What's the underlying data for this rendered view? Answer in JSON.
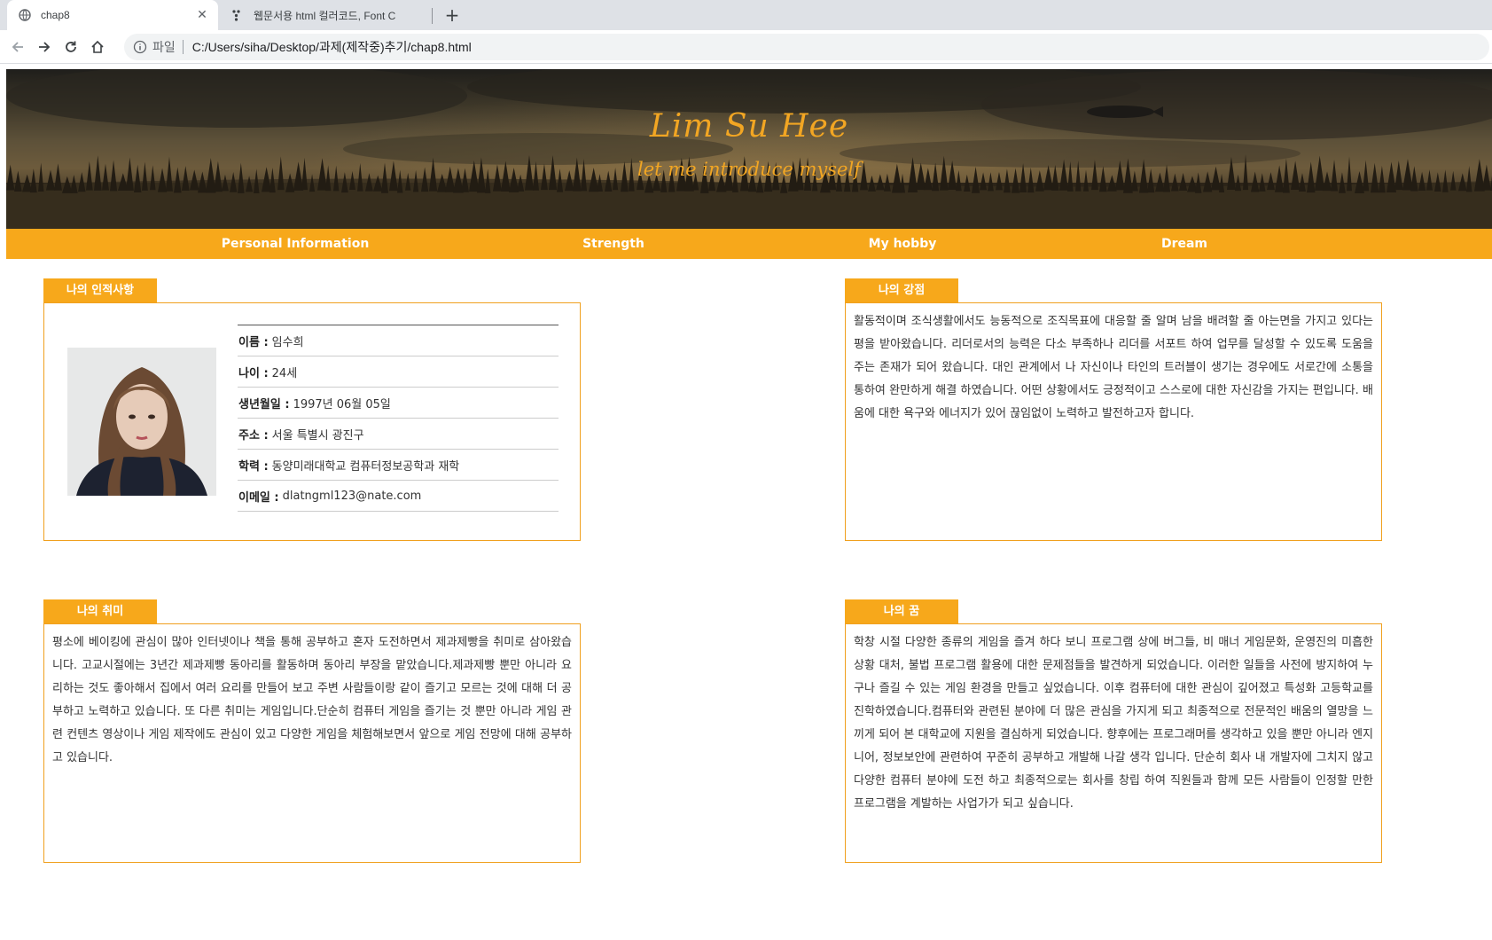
{
  "browser": {
    "tabs": [
      {
        "title": "chap8",
        "active": true
      },
      {
        "title": "웹문서용 html 컬러코드, Font C",
        "active": false
      }
    ],
    "address": {
      "scheme_label": "파일",
      "url": "C:/Users/siha/Desktop/과제(제작중)추기/chap8.html"
    }
  },
  "header": {
    "title": "Lim Su Hee",
    "subtitle": "let me introduce myself"
  },
  "nav": {
    "items": [
      "Personal Information",
      "Strength",
      "My hobby",
      "Dream"
    ]
  },
  "personal": {
    "label": "나의 인적사항",
    "rows": [
      {
        "key": "이름 :",
        "value": "임수희"
      },
      {
        "key": "나이 :",
        "value": "24세"
      },
      {
        "key": "생년월일 :",
        "value": "1997년 06월 05일"
      },
      {
        "key": "주소 :",
        "value": "서울 특별시 광진구"
      },
      {
        "key": "학력 :",
        "value": "동양미래대학교 컴퓨터정보공학과 재학"
      },
      {
        "key": "이메일 :",
        "value": "dlatngml123@nate.com"
      }
    ]
  },
  "strength": {
    "label": "나의 강점",
    "text": "활동적이며 조식생활에서도 능동적으로 조직목표에 대응할 줄 알며 남을 배려할 줄 아는면을 가지고 있다는 평을 받아왔습니다. 리더로서의 능력은 다소 부족하나 리더를 서포트 하여 업무를 달성할 수 있도록 도움을 주는 존재가 되어 왔습니다. 대인 관계에서 나 자신이나 타인의 트러블이 생기는 경우에도 서로간에 소통을 통하여 완만하게 해결 하였습니다. 어떤 상황에서도 긍정적이고 스스로에 대한 자신감을 가지는 편입니다. 배움에 대한 욕구와 에너지가 있어 끊임없이 노력하고 발전하고자 합니다."
  },
  "hobby": {
    "label": "나의 취미",
    "text": "평소에 베이킹에 관심이 많아 인터넷이나 책을 통해 공부하고 혼자 도전하면서 제과제빵을 취미로 삼아왔습니다. 고교시절에는 3년간 제과제빵 동아리를 활동하며 동아리 부장을 맡았습니다.제과제빵 뿐만 아니라 요리하는 것도 좋아해서 집에서 여러 요리를 만들어 보고 주변 사람들이랑 같이 즐기고 모르는 것에 대해 더 공부하고 노력하고 있습니다. 또 다른 취미는 게임입니다.단순히 컴퓨터 게임을 즐기는 것 뿐만 아니라 게임 관련 컨텐츠 영상이나 게임 제작에도 관심이 있고 다양한 게임을 체험해보면서 앞으로 게임 전망에 대해 공부하고 있습니다."
  },
  "dream": {
    "label": "나의 꿈",
    "text": "학창 시절 다양한 종류의 게임을 즐겨 하다 보니 프로그램 상에 버그들, 비 매너 게임문화, 운영진의 미흡한 상황 대처, 불법 프로그램 활용에 대한 문제점들을 발견하게 되었습니다. 이러한 일들을 사전에 방지하여 누구나 즐길 수 있는 게임 환경을 만들고 싶었습니다. 이후 컴퓨터에 대한 관심이 깊어졌고 특성화 고등학교를 진학하였습니다.컴퓨터와 관련된 분야에 더 많은 관심을 가지게 되고 최종적으로 전문적인 배움의 열망을 느끼게 되어 본 대학교에 지원을 결심하게 되었습니다. 향후에는 프로그래머를 생각하고 있을 뿐만 아니라 엔지니어, 정보보안에 관련하여 꾸준히 공부하고 개발해 나갈 생각 입니다. 단순히 회사 내 개발자에 그치지 않고 다양한 컴퓨터 분야에 도전 하고 최종적으로는 회사를 창립 하여 직원들과 함께 모든 사람들이 인정할 만한 프로그램을 계발하는 사업가가 되고 싶습니다."
  },
  "colors": {
    "accent": "#f7a81b",
    "title_text": "#f2a623",
    "border": "#f0a01e"
  }
}
